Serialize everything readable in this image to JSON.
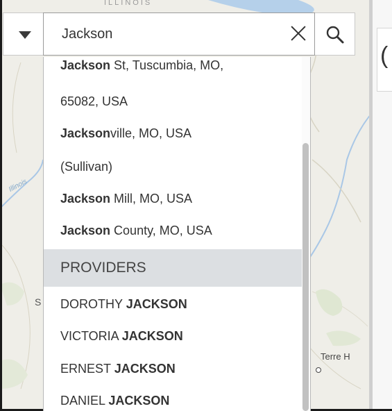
{
  "map": {
    "state_label": "ILLINOIS",
    "river_label": "Illinois",
    "city_partial_label": "S",
    "city_label": "Terre H"
  },
  "side_panel": {
    "partial_glyph": "("
  },
  "search": {
    "source_icon": "caret-down-icon",
    "value": "Jackson",
    "clear_icon": "close-icon",
    "search_icon": "magnifier-icon"
  },
  "suggestions": {
    "locations": [
      {
        "match": "Jackson",
        "rest": " St, Tuscumbia, MO,"
      },
      {
        "match": "",
        "rest": "65082, USA"
      },
      {
        "match": "Jackson",
        "rest": "ville, MO, USA"
      },
      {
        "match": "",
        "rest": "(Sullivan)"
      },
      {
        "match": "Jackson",
        "rest": " Mill, MO, USA"
      },
      {
        "match": "Jackson",
        "rest": " County, MO, USA"
      }
    ],
    "providers_header": "PROVIDERS",
    "providers": [
      {
        "first": "DOROTHY ",
        "match": "JACKSON"
      },
      {
        "first": "VICTORIA ",
        "match": "JACKSON"
      },
      {
        "first": "ERNEST ",
        "match": "JACKSON"
      },
      {
        "first": "DANIEL ",
        "match": "JACKSON"
      }
    ]
  }
}
